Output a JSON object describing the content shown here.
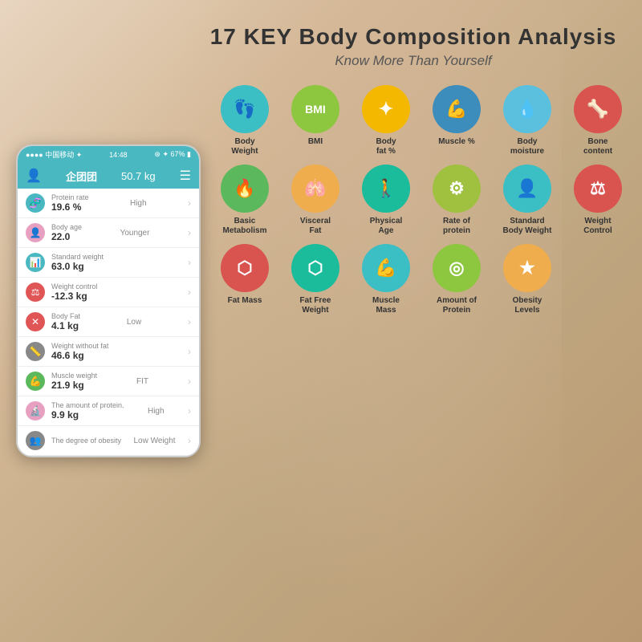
{
  "header": {
    "main_title": "17 KEY Body Composition Analysis",
    "sub_title": "Know More Than Yourself"
  },
  "icons": [
    {
      "id": "body-weight",
      "label": "Body\nWeight",
      "symbol": "👣",
      "color": "c-teal"
    },
    {
      "id": "bmi",
      "label": "BMI",
      "symbol": "BMI",
      "color": "c-green",
      "text": true
    },
    {
      "id": "body-fat",
      "label": "Body\nfat %",
      "symbol": "✦",
      "color": "c-yellow"
    },
    {
      "id": "muscle-pct",
      "label": "Muscle %",
      "symbol": "💪",
      "color": "c-blue"
    },
    {
      "id": "body-moisture",
      "label": "Body\nmoisture",
      "symbol": "💧",
      "color": "c-lblue"
    },
    {
      "id": "bone-content",
      "label": "Bone\ncontent",
      "symbol": "🦴",
      "color": "c-red"
    },
    {
      "id": "basic-metabolism",
      "label": "Basic\nMetabolism",
      "symbol": "🔥",
      "color": "c-dgreen"
    },
    {
      "id": "visceral-fat",
      "label": "Visceral\nFat",
      "symbol": "🫁",
      "color": "c-orange"
    },
    {
      "id": "physical-age",
      "label": "Physical\nAge",
      "symbol": "🚶",
      "color": "c-cyan"
    },
    {
      "id": "rate-protein",
      "label": "Rate of\nprotein",
      "symbol": "⚙",
      "color": "c-lgreen"
    },
    {
      "id": "standard-body",
      "label": "Standard\nBody Weight",
      "symbol": "👤",
      "color": "c-teal"
    },
    {
      "id": "weight-control",
      "label": "Weight\nControl",
      "symbol": "⚖",
      "color": "c-red"
    },
    {
      "id": "fat-mass",
      "label": "Fat Mass",
      "symbol": "⬡",
      "color": "c-red"
    },
    {
      "id": "fat-free-weight",
      "label": "Fat Free\nWeight",
      "symbol": "⬡",
      "color": "c-cyan"
    },
    {
      "id": "muscle-mass",
      "label": "Muscle\nMass",
      "symbol": "💪",
      "color": "c-teal"
    },
    {
      "id": "amount-protein",
      "label": "Amount of\nProtein",
      "symbol": "◎",
      "color": "c-green"
    },
    {
      "id": "obesity-levels",
      "label": "Obesity\nLevels",
      "symbol": "★",
      "color": "c-orange"
    }
  ],
  "phone": {
    "status": "中国移动 ✦",
    "time": "14:48",
    "battery": "67%",
    "user_name": "企团团",
    "weight": "50.7 kg",
    "rows": [
      {
        "label": "Protein rate",
        "value": "19.6 %",
        "status": "High",
        "icon_color": "#4ab8c1",
        "symbol": "🧬"
      },
      {
        "label": "Body age",
        "value": "22.0",
        "status": "Younger",
        "icon_color": "#e8a0c0",
        "symbol": "👤"
      },
      {
        "label": "Standard weight",
        "value": "63.0 kg",
        "status": "",
        "icon_color": "#4ab8c1",
        "symbol": "📊"
      },
      {
        "label": "Weight control",
        "value": "-12.3 kg",
        "status": "",
        "icon_color": "#e05555",
        "symbol": "⚖"
      },
      {
        "label": "Body Fat",
        "value": "4.1 kg",
        "status": "Low",
        "icon_color": "#e05555",
        "symbol": "✕"
      },
      {
        "label": "Weight without fat",
        "value": "46.6 kg",
        "status": "",
        "icon_color": "#888",
        "symbol": "📏"
      },
      {
        "label": "Muscle weight",
        "value": "21.9 kg",
        "status": "FIT",
        "icon_color": "#5cb85c",
        "symbol": "💪"
      },
      {
        "label": "The amount of protein.",
        "value": "9.9 kg",
        "status": "High",
        "icon_color": "#e8a0c0",
        "symbol": "🔬"
      },
      {
        "label": "The degree of obesity",
        "value": "",
        "status": "Low Weight",
        "icon_color": "#888",
        "symbol": "👥"
      }
    ]
  }
}
